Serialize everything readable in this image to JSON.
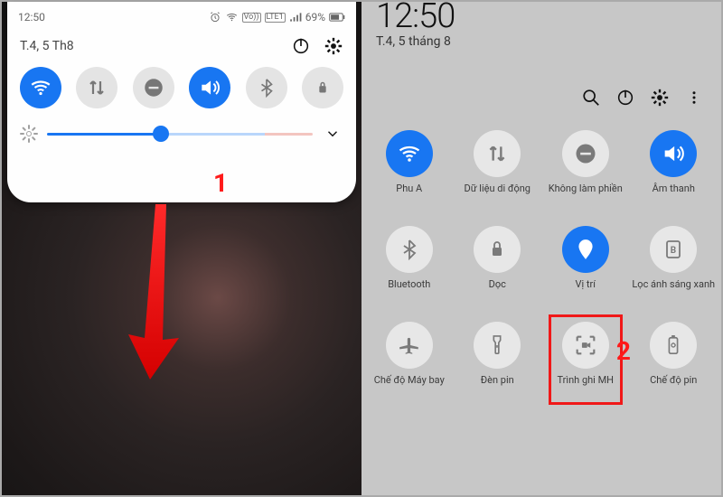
{
  "left": {
    "time": "12:50",
    "date": "T.4, 5 Th8",
    "battery": "69%",
    "lte": "LTE1",
    "vo": "Vo))",
    "brightness_pct": 43
  },
  "right": {
    "time": "12:50",
    "date": "T.4, 5 tháng 8",
    "tiles": [
      {
        "label": "Phu A",
        "on": true,
        "icon": "wifi"
      },
      {
        "label": "Dữ liệu di động",
        "on": false,
        "icon": "data"
      },
      {
        "label": "Không làm phiền",
        "on": false,
        "icon": "dnd"
      },
      {
        "label": "Âm thanh",
        "on": true,
        "icon": "sound"
      },
      {
        "label": "Bluetooth",
        "on": false,
        "icon": "bt"
      },
      {
        "label": "Dọc",
        "on": false,
        "icon": "lock"
      },
      {
        "label": "Vị trí",
        "on": true,
        "icon": "loc"
      },
      {
        "label": "Lọc ánh sáng xanh",
        "on": false,
        "icon": "filter"
      },
      {
        "label": "Chế độ Máy bay",
        "on": false,
        "icon": "plane"
      },
      {
        "label": "Đèn pin",
        "on": false,
        "icon": "torch"
      },
      {
        "label": "Trình ghi MH",
        "on": false,
        "icon": "rec",
        "highlight": true
      },
      {
        "label": "Chế độ pin",
        "on": false,
        "icon": "batt"
      }
    ]
  },
  "annotations": {
    "step1": "1",
    "step2": "2"
  }
}
